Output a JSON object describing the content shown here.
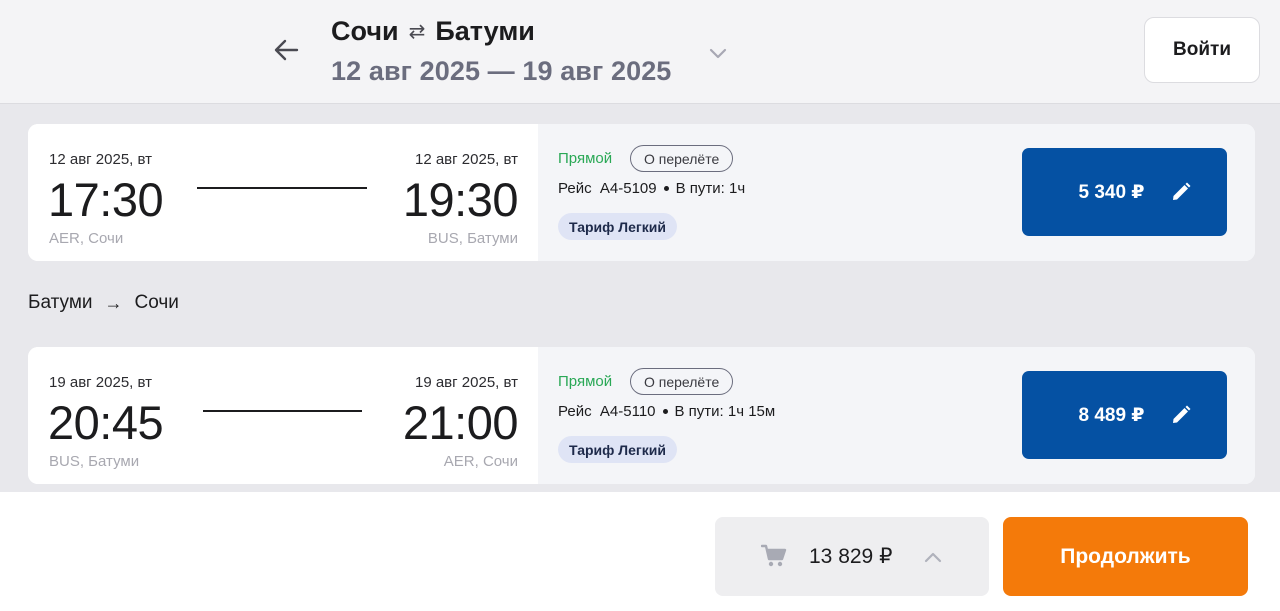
{
  "header": {
    "origin": "Сочи",
    "swap_icon": "⇄",
    "destination": "Батуми",
    "dates": "12 авг 2025 — 19 авг 2025",
    "login_label": "Войти"
  },
  "outbound": {
    "dep_date": "12 авг 2025, вт",
    "dep_time": "17:30",
    "dep_airport": "AER, Сочи",
    "arr_date": "12 авг 2025, вт",
    "arr_time": "19:30",
    "arr_airport": "BUS, Батуми",
    "direct_label": "Прямой",
    "about_label": "О перелёте",
    "flight_number": "Рейс  A4-5109",
    "duration": "В пути: 1ч",
    "fare": "Тариф Легкий",
    "price": "5 340 ₽"
  },
  "return_section": {
    "from": "Батуми",
    "arrow": "→",
    "to": "Сочи"
  },
  "inbound": {
    "dep_date": "19 авг 2025, вт",
    "dep_time": "20:45",
    "dep_airport": "BUS, Батуми",
    "arr_date": "19 авг 2025, вт",
    "arr_time": "21:00",
    "arr_airport": "AER, Сочи",
    "direct_label": "Прямой",
    "about_label": "О перелёте",
    "flight_number": "Рейс  A4-5110",
    "duration": "В пути: 1ч 15м",
    "fare": "Тариф Легкий",
    "price": "8 489 ₽"
  },
  "footer": {
    "total": "13 829 ₽",
    "continue_label": "Продолжить"
  },
  "colors": {
    "accent_blue": "#0551a3",
    "accent_orange": "#f47a0a",
    "direct_green": "#2aa856"
  },
  "icons": {
    "back": "arrow-left-icon",
    "expand": "chevron-down-icon",
    "edit": "pencil-icon",
    "cart": "cart-icon",
    "collapse": "chevron-up-icon"
  }
}
